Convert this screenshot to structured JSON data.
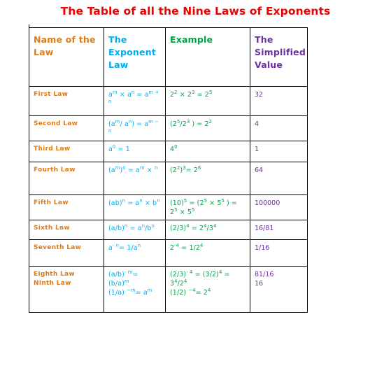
{
  "page": {
    "title": "The Table of all the Nine Laws of Exponents",
    "title_color": "#EE0000",
    "background": "#FFFFFF"
  },
  "colors": {
    "name_column": "#E07B16",
    "exponent_law_column": "#00AEEF",
    "example_column": "#00A14B",
    "simplified_value_column": "#6B2FA0",
    "border": "#000000"
  },
  "table": {
    "headers": [
      {
        "label": "Name of the Law",
        "color": "#E07B16"
      },
      {
        "label": "The Exponent Law",
        "color": "#00AEEF"
      },
      {
        "label": "Example",
        "color": "#00A14B"
      },
      {
        "label": "The Simplified Value",
        "color": "#6B2FA0"
      }
    ],
    "rows": [
      {
        "name": "First Law",
        "law_html": "a<sup>m</sup> &times; a<sup>n</sup> = a<sup>m + n</sup>",
        "example_html": "2<sup>2</sup> &times; 2<sup>3</sup> = 2<sup>5</sup>",
        "value": "32"
      },
      {
        "name": "Second Law",
        "law_html": "(a<sup>m</sup>/ a<sup>n</sup>) = a<sup>m &minus; n</sup>",
        "example_html": "(2<sup>5</sup>/2<sup>3</sup> ) = 2<sup>2</sup>",
        "value": "4"
      },
      {
        "name": "Third Law",
        "law_html": "a<sup>0</sup> = 1",
        "example_html": "4<sup>0</sup>",
        "value": "1"
      },
      {
        "name": "Fourth Law",
        "law_html": "(a<sup>m</sup>)<sup>n</sup> = a<sup>m</sup> &times; <sup>n</sup>",
        "example_html": "(2<sup>2</sup>)<sup>3</sup>= 2<sup>6</sup>",
        "value": "64"
      },
      {
        "name": "Fifth Law",
        "law_html": "(ab)<sup>n</sup> = a<sup>n</sup> &times; b<sup>n</sup>",
        "example_html": "(10)<sup>5</sup> = (2<sup>5</sup> &times; 5<sup>5</sup> ) = 2<sup>5</sup> &times; 5<sup>5</sup>",
        "value": "100000"
      },
      {
        "name": "Sixth Law",
        "law_html": "(a/b)<sup>n</sup> = a<sup>n</sup>/b<sup>n</sup>",
        "example_html": "(2/3)<sup>4</sup> = 2<sup>4</sup>/3<sup>4</sup>",
        "value": "16/81"
      },
      {
        "name": "Seventh Law",
        "law_html": "a<sup>- n</sup>= 1/a<sup>n</sup>",
        "example_html": "2<sup>-4</sup> = 1/2<sup>4</sup>",
        "value": "1/16"
      },
      {
        "name": "Eighth Law",
        "law_html": "(a/b)<sup>- m</sup>= (b/a)<sup>m</sup>",
        "example_html": "(2/3)<sup>- 4</sup> = (3/2)<sup>4</sup> = 3<sup>4</sup>/2<sup>4</sup>",
        "value": "81/16"
      },
      {
        "name": "Ninth Law",
        "law_html": "(1/a) <sup>&minus;m</sup>= a<sup>m</sup>",
        "example_html": "(1/2) <sup>&minus;4</sup>= 2<sup>4</sup>",
        "value": "16"
      }
    ]
  }
}
